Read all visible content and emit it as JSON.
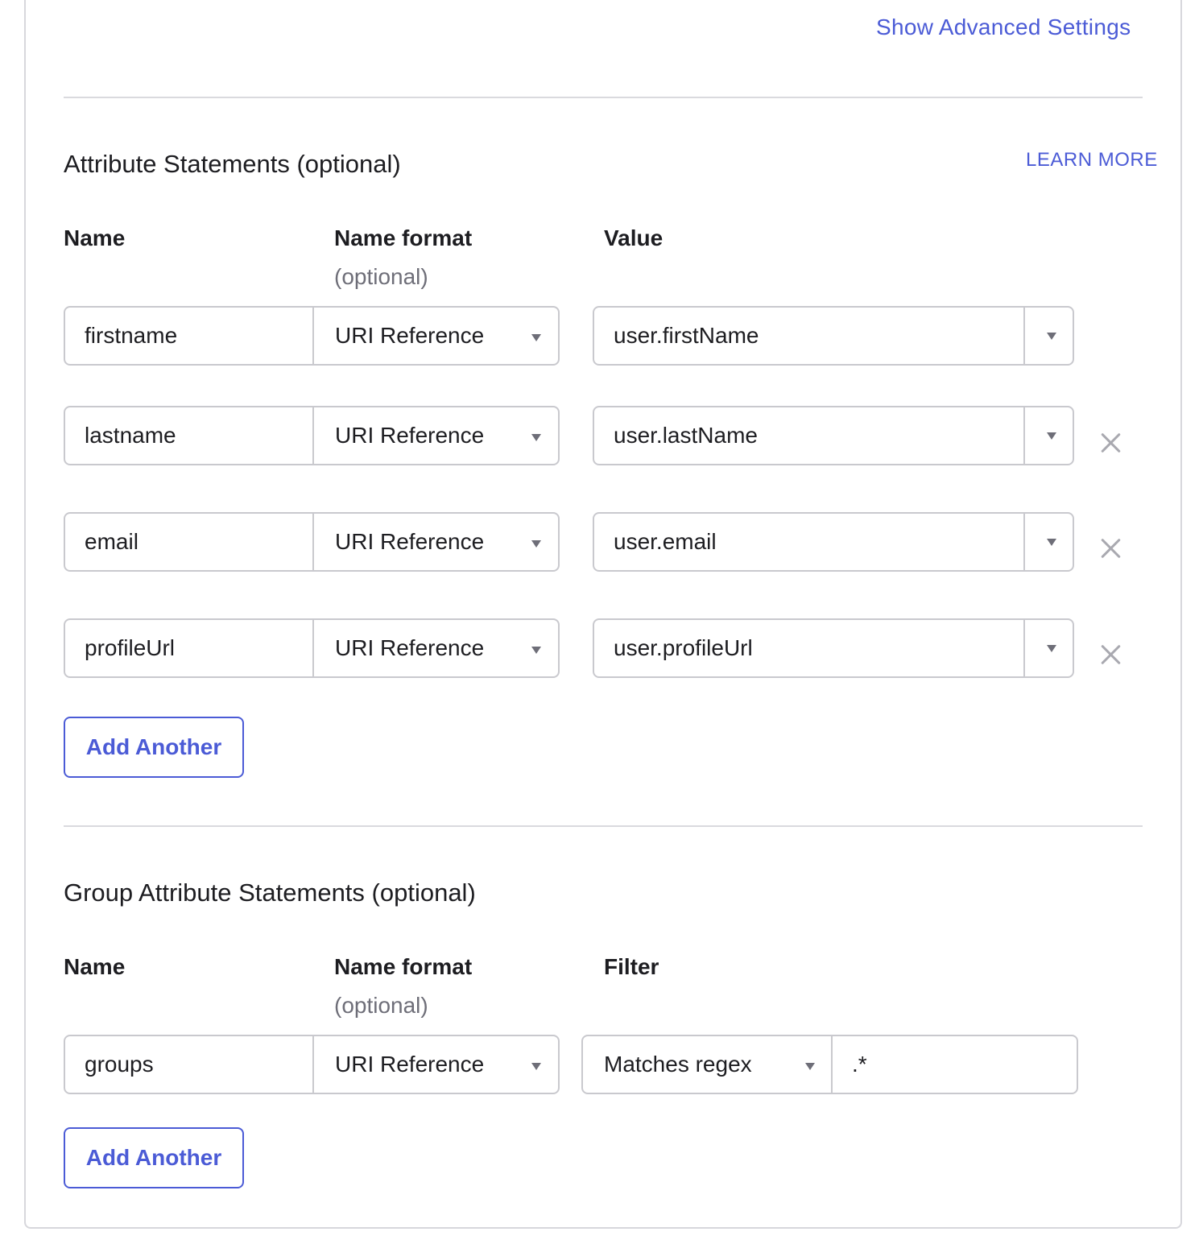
{
  "header": {
    "advanced_link": "Show Advanced Settings"
  },
  "attributes": {
    "title": "Attribute Statements (optional)",
    "learn_more": "LEARN MORE",
    "columns": {
      "name": "Name",
      "format": "Name format",
      "format_sub": "(optional)",
      "value": "Value"
    },
    "rows": [
      {
        "name": "firstname",
        "format": "URI Reference",
        "value": "user.firstName"
      },
      {
        "name": "lastname",
        "format": "URI Reference",
        "value": "user.lastName"
      },
      {
        "name": "email",
        "format": "URI Reference",
        "value": "user.email"
      },
      {
        "name": "profileUrl",
        "format": "URI Reference",
        "value": "user.profileUrl"
      }
    ],
    "add_button": "Add Another"
  },
  "groups": {
    "title": "Group Attribute Statements (optional)",
    "columns": {
      "name": "Name",
      "format": "Name format",
      "format_sub": "(optional)",
      "filter": "Filter"
    },
    "rows": [
      {
        "name": "groups",
        "format": "URI Reference",
        "filter_type": "Matches regex",
        "filter_value": ".*"
      }
    ],
    "add_button": "Add Another"
  },
  "icons": {
    "remove": "close-icon",
    "dropdown": "caret-down-icon"
  },
  "colors": {
    "accent": "#4b5bd6",
    "border": "#c9c9ce",
    "muted": "#6e6e78"
  }
}
